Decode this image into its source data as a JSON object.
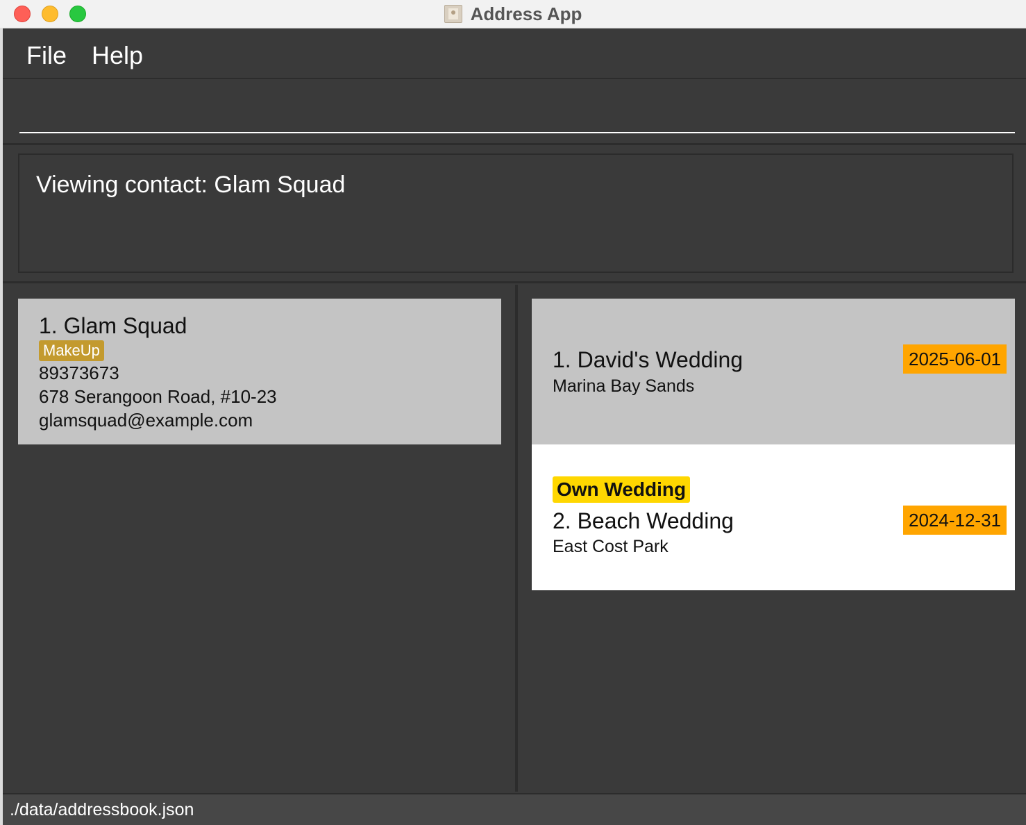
{
  "window": {
    "title": "Address App"
  },
  "menu": {
    "file": "File",
    "help": "Help"
  },
  "command": {
    "value": "",
    "placeholder": ""
  },
  "result": {
    "message": "Viewing contact: Glam Squad"
  },
  "person": {
    "name": "1. Glam Squad",
    "tag": "MakeUp",
    "phone": "89373673",
    "address": "678 Serangoon Road, #10-23",
    "email": "glamsquad@example.com"
  },
  "weddings": [
    {
      "name": "1. David's Wedding",
      "location": "Marina Bay Sands",
      "date": "2025-06-01",
      "tag": ""
    },
    {
      "name": "2. Beach Wedding",
      "location": "East Cost Park",
      "date": "2024-12-31",
      "tag": "Own Wedding"
    }
  ],
  "status": {
    "path": "./data/addressbook.json"
  },
  "colors": {
    "background": "#3a3a3a",
    "card_selected": "#c4c4c4",
    "tag_makeup": "#c39a2e",
    "date_badge": "#ffa500",
    "own_wedding_tag": "#ffd700"
  }
}
